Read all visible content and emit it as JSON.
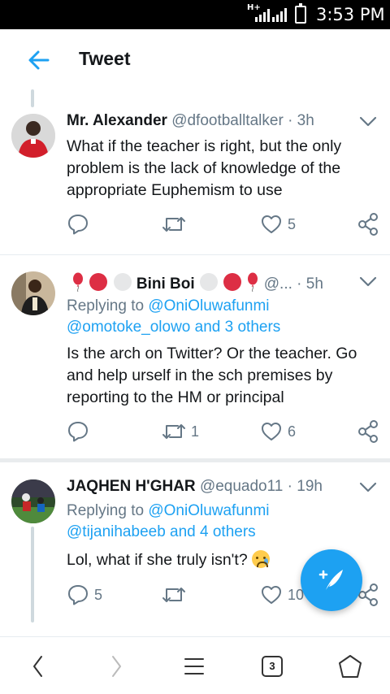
{
  "status_bar": {
    "network": "H+",
    "time": "3:53 PM"
  },
  "header": {
    "title": "Tweet"
  },
  "tweets": [
    {
      "name": "Mr. Alexander",
      "handle": "@dfootballtalker",
      "dot": "·",
      "time": "3h",
      "text": "What if the teacher is right, but the only problem is the lack of knowledge of the appropriate Euphemism to use",
      "likes": "5"
    },
    {
      "name": "Bini Boi",
      "handle": "@...",
      "dot": "·",
      "time": "5h",
      "replying_prefix": "Replying to",
      "replying_user": "@OniOluwafunmi",
      "replying_more": "@omotoke_olowo and 3 others",
      "text": "Is the arch on Twitter? Or the teacher. Go and help urself in the sch premises by reporting to the HM or principal",
      "retweets": "1",
      "likes": "6"
    },
    {
      "name": "JAQHEN H'GHAR",
      "handle": "@equado11",
      "dot": "·",
      "time": "19h",
      "replying_prefix": "Replying to",
      "replying_user": "@OniOluwafunmi",
      "replying_more": "@tijanihabeeb and 4 others",
      "text": "Lol, what if she truly isn't?",
      "replies": "5",
      "likes": "10"
    }
  ],
  "bottom_nav": {
    "tab_count": "3"
  },
  "colors": {
    "accent": "#1da1f2",
    "text": "#14171a",
    "muted": "#657786",
    "divider": "#e6ecf0"
  },
  "icons": [
    "back-arrow-icon",
    "chevron-down-icon",
    "reply-icon",
    "retweet-icon",
    "like-icon",
    "share-icon",
    "compose-icon",
    "balloon-icon",
    "red-circle-icon",
    "white-circle-icon"
  ]
}
